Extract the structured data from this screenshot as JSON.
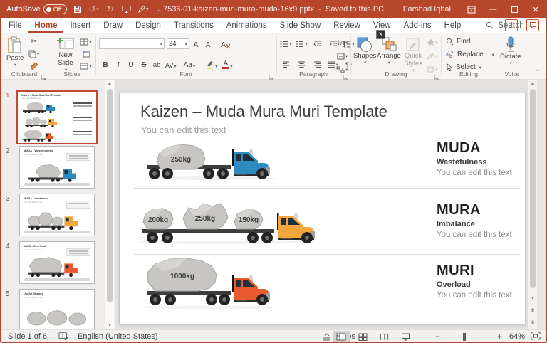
{
  "window": {
    "autosave_label": "AutoSave",
    "autosave_state": "Off",
    "file_name": "7536-01-kaizen-muri-mura-muda-16x9.pptx",
    "separator": "-",
    "save_status": "Saved to this PC",
    "user_name": "Farshad Iqbal"
  },
  "tabs": {
    "file": "File",
    "home": "Home",
    "insert": "Insert",
    "draw": "Draw",
    "design": "Design",
    "transitions": "Transitions",
    "animations": "Animations",
    "slide_show": "Slide Show",
    "review": "Review",
    "view": "View",
    "addins": "Add-ins",
    "help": "Help",
    "search": "Search",
    "keytip": "X"
  },
  "ribbon": {
    "clipboard": {
      "label": "Clipboard",
      "paste": "Paste"
    },
    "slides": {
      "label": "Slides",
      "new_slide": "New Slide"
    },
    "font": {
      "label": "Font",
      "size": "24",
      "bold": "B",
      "italic": "I",
      "underline": "U",
      "strikethrough": "S",
      "sub": "ab",
      "spacing": "AV",
      "case": "Aa"
    },
    "paragraph": {
      "label": "Paragraph"
    },
    "drawing": {
      "label": "Drawing",
      "shapes": "Shapes",
      "arrange": "Arrange",
      "quick_styles": "Quick Styles"
    },
    "editing": {
      "label": "Editing",
      "find": "Find",
      "replace": "Replace",
      "select": "Select"
    },
    "voice": {
      "label": "Voice",
      "dictate": "Dictate"
    }
  },
  "thumbnails": {
    "items": [
      {
        "number": "1",
        "title": "Kaizen – Muda Mura Muri Template"
      },
      {
        "number": "2",
        "title": "MUDA - Wastefulness"
      },
      {
        "number": "3",
        "title": "MURA - Imbalance"
      },
      {
        "number": "4",
        "title": "MURI - Overload"
      },
      {
        "number": "5",
        "title": "Useful Shapes"
      }
    ],
    "subtitle": "You can edit this text"
  },
  "slide": {
    "title": "Kaizen – Muda Mura Muri Template",
    "subtitle": "You can edit this text",
    "rows": [
      {
        "term": "MUDA",
        "meaning": "Wastefulness",
        "desc": "You can edit this text",
        "truck_color": "#2e8bc0",
        "rocks": [
          "250kg"
        ]
      },
      {
        "term": "MURA",
        "meaning": "Imbalance",
        "desc": "You can edit this text",
        "truck_color": "#f2a73e",
        "rocks": [
          "200kg",
          "250kg",
          "150kg"
        ]
      },
      {
        "term": "MURI",
        "meaning": "Overload",
        "desc": "You can edit this text",
        "truck_color": "#e95b2e",
        "rocks": [
          "1000kg"
        ]
      }
    ]
  },
  "statusbar": {
    "slide_indicator": "Slide 1 of 6",
    "language": "English (United States)",
    "notes_label": "Notes",
    "zoom_level": "64%"
  },
  "colors": {
    "titlebar": "#b7472a",
    "accent": "#c0492c",
    "rock_fill": "#c8c6c3"
  }
}
